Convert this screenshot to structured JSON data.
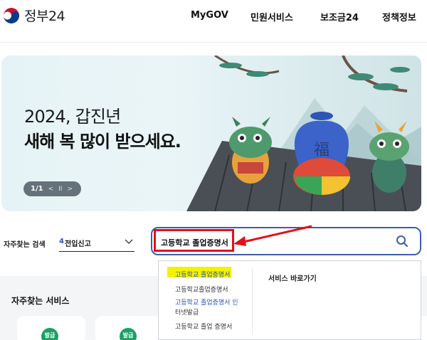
{
  "header": {
    "logo_text": "정부24",
    "nav": [
      "MyGOV",
      "민원서비스",
      "보조금24",
      "정책정보"
    ]
  },
  "banner": {
    "title_line1": "2024, 갑진년",
    "title_line2": "새해 복 많이 받으세요.",
    "pager": {
      "current": "1/1",
      "prev": "<",
      "pause": "II",
      "next": ">"
    },
    "pouch_char": "福"
  },
  "search": {
    "frequent_label": "자주찾는 검색",
    "frequent_rank": "4",
    "frequent_term": "전입신고",
    "query": "고등학교 졸업증명서"
  },
  "autocomplete": {
    "items": [
      "고등학교 졸업증명서",
      "고등학교졸업증명서",
      "고등학교 졸업증명서 인",
      "터넷발급",
      "고등학교 졸업 증명서"
    ],
    "shortcut_title": "서비스 바로가기"
  },
  "services": {
    "title": "자주찾는 서비스",
    "badge_label": "발급"
  },
  "colors": {
    "accent_blue": "#3d5fa8",
    "annotation_red": "#e0111b",
    "highlight_yellow": "#f4f200",
    "badge_green": "#18a266"
  }
}
